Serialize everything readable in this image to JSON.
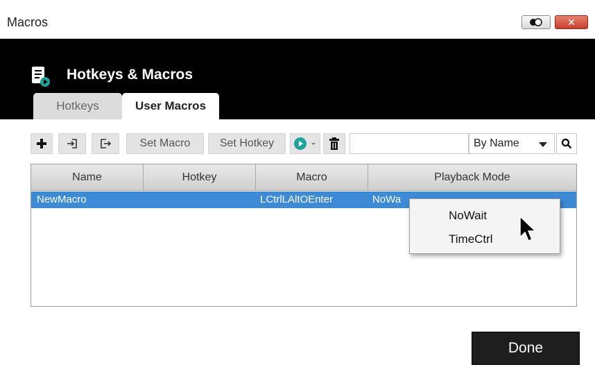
{
  "window": {
    "title": "Macros",
    "close_glyph": "✕"
  },
  "header": {
    "app_title": "Hotkeys & Macros",
    "app_icon": "macro-document-play-icon"
  },
  "tabs": [
    {
      "label": "Hotkeys",
      "active": false
    },
    {
      "label": "User Macros",
      "active": true
    }
  ],
  "toolbar": {
    "add_icon": "plus-icon",
    "import_icon": "import-icon",
    "export_icon": "export-icon",
    "set_macro_label": "Set Macro",
    "set_hotkey_label": "Set Hotkey",
    "play_icon": "play-icon",
    "delete_icon": "trash-icon",
    "search_value": "",
    "sort_selected": "By Name",
    "search_icon": "search-icon"
  },
  "table": {
    "columns": [
      "Name",
      "Hotkey",
      "Macro",
      "Playback Mode"
    ],
    "rows": [
      {
        "name": "NewMacro",
        "hotkey": "",
        "macro": "LCtrlLAltOEnter",
        "playback": "NoWa"
      }
    ],
    "selected_row_color": "#3d8ad6"
  },
  "playback_menu": {
    "options": [
      "NoWait",
      "TimeCtrl"
    ]
  },
  "footer": {
    "done_label": "Done"
  },
  "colors": {
    "header_bg": "#000000",
    "close_button": "#c7402b",
    "done_button": "#1e1e1e"
  }
}
